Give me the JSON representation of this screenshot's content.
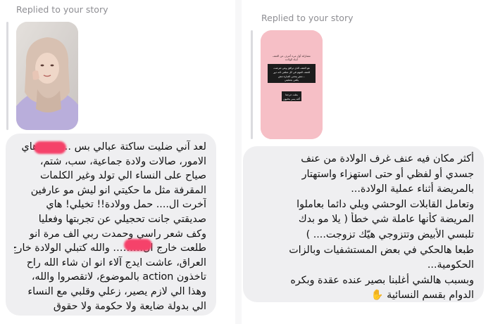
{
  "left_message": {
    "reply_label": "Replied to your story",
    "story": {
      "description": "Story thumbnail"
    },
    "lines": [
      "لعد آني ضليت ساكتة عبالي بس ……… هاي",
      "الامور، صالات ولادة جماعية، سب، شتم،",
      "صياح على النساء الي تولد وغير الكلمات",
      "المقرفة مثل ما حكيتي انو ليش مو عارفين",
      "آخرت ال.... حمل وولادة!! تخيلي! هاي",
      "صديقتي جانت تحجيلي عن تجربتها وفعليا",
      "وكف شعر راسي وحمدت ربي الف مرة انو",
      "طلعت خارج ال……… والله كتبلي الولادة خارج",
      "العراق، عاشت ايدج آلاء انو ان شاء الله راح",
      "تاخذون action بالموضوع، لاتقصروا والله،",
      "وهذا الي لازم يصير، زعلي وقلبي مع النساء",
      "الي بدولة ضايعة ولا حكومة ولا حقوق"
    ]
  },
  "right_message": {
    "reply_label": "Replied to your story",
    "story": {
      "text_lines": [
        "مشاركة أول مرة أعرف عن العنف",
        "أثناء الولادة",
        "هو العنف الذي ترافق وهي تعرضت",
        "للعنف المهم في كل متلقي لانه دور",
        "مش ينحني العبارة مش...",
        "يكفي بعمليتي",
        "بعلت حرجعا",
        "ألله يسر يخليهن"
      ]
    },
    "lines": [
      "أكثر مكان فيه عنف غرف الولادة من عنف",
      "جسدي أو لفظي أو حتى استهزاء واستهتار",
      "بالمريضة أثناء عملية الولادة...",
      "وتعامل القابلات الوحشي ويلي دائما بعاملوا",
      "المريضة كأنها عاملة شي خطأ ( يلا مو بدك",
      "تلبسي الأبيض وتتزوجي هيّك تزوجت.... )",
      "طبعا هالحكي في بعض المستشفيات وبالزات",
      "الحكومية...",
      "وبسبب هالشي أغلبنا بصير عنده  عقدة وبكره",
      "الدوام بقسم النسائية"
    ],
    "emoji": "✋"
  }
}
